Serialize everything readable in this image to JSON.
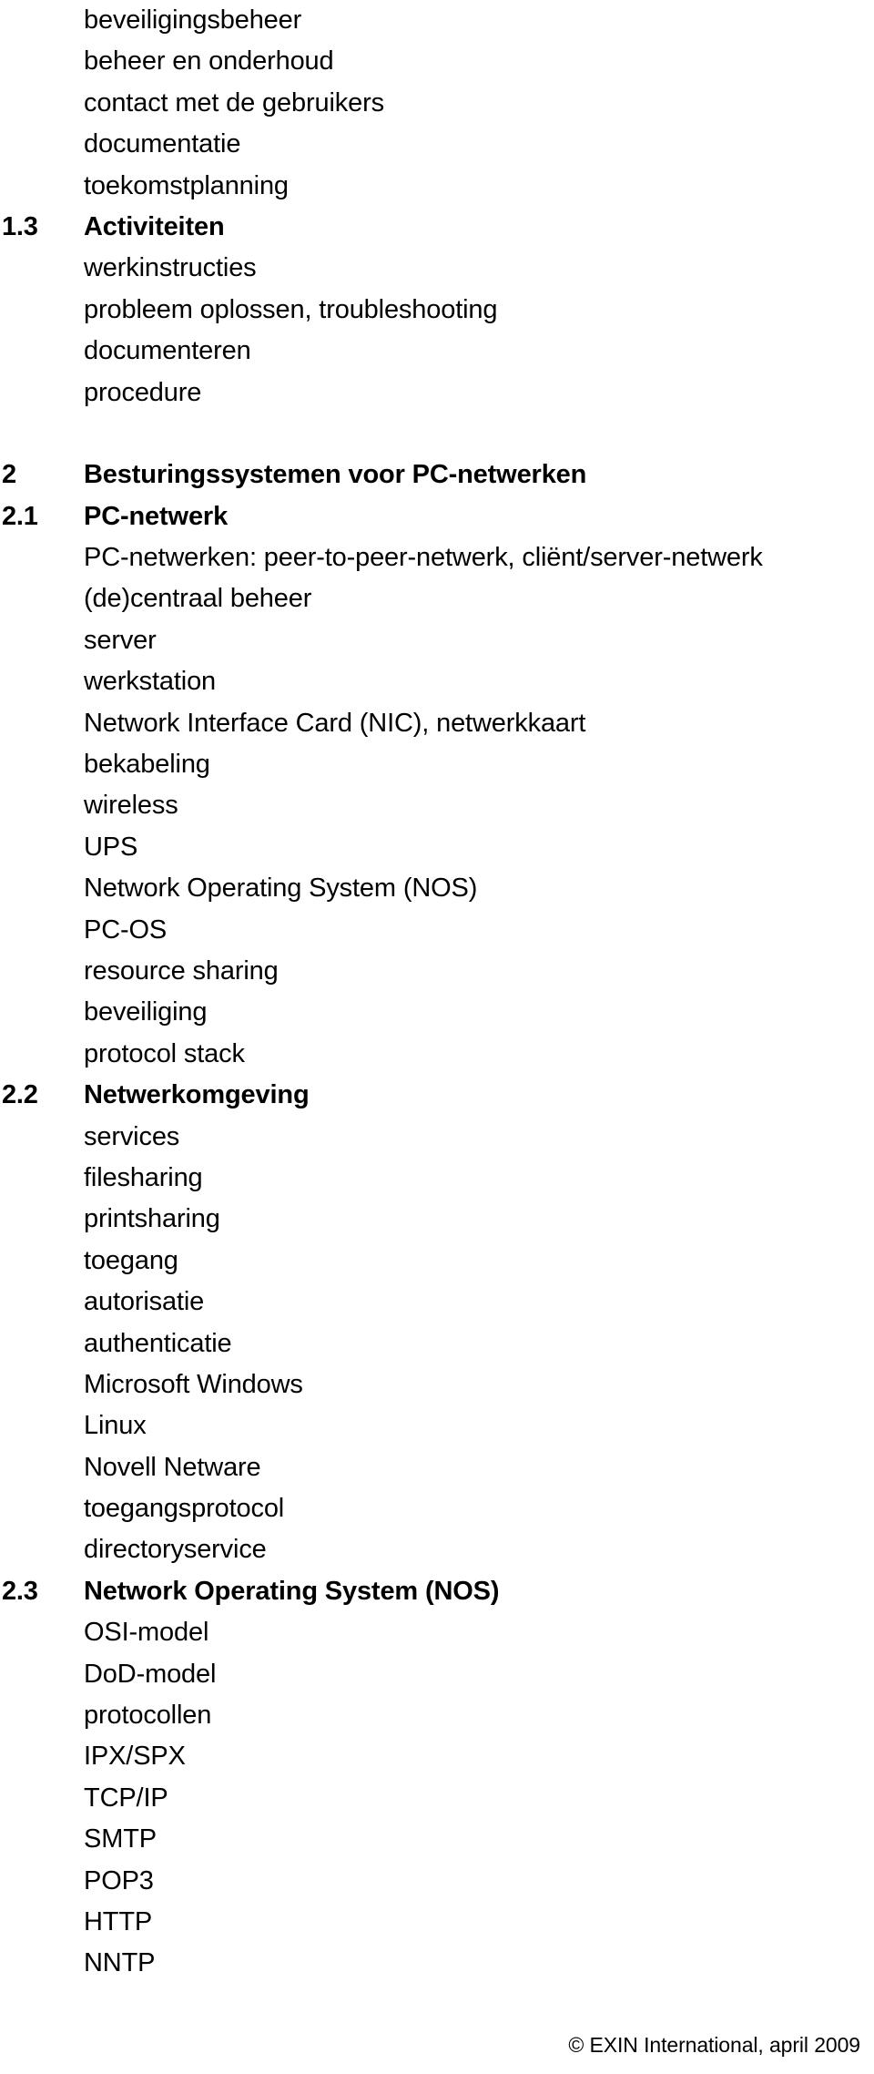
{
  "document": {
    "footer": "© EXIN International, april 2009"
  },
  "outline": {
    "rows": [
      {
        "num": "",
        "text": "beveiligingsbeheer",
        "heading": false
      },
      {
        "num": "",
        "text": "beheer en onderhoud",
        "heading": false
      },
      {
        "num": "",
        "text": "contact met de gebruikers",
        "heading": false
      },
      {
        "num": "",
        "text": "documentatie",
        "heading": false
      },
      {
        "num": "",
        "text": "toekomstplanning",
        "heading": false
      },
      {
        "num": "1.3",
        "text": "Activiteiten",
        "heading": true
      },
      {
        "num": "",
        "text": "werkinstructies",
        "heading": false
      },
      {
        "num": "",
        "text": "probleem oplossen, troubleshooting",
        "heading": false
      },
      {
        "num": "",
        "text": "documenteren",
        "heading": false
      },
      {
        "num": "",
        "text": "procedure",
        "heading": false
      },
      {
        "num": "",
        "text": "",
        "heading": false
      },
      {
        "num": "2",
        "text": "Besturingssystemen voor PC-netwerken",
        "heading": true
      },
      {
        "num": "2.1",
        "text": "PC-netwerk",
        "heading": true
      },
      {
        "num": "",
        "text": "PC-netwerken: peer-to-peer-netwerk, cliënt/server-netwerk",
        "heading": false
      },
      {
        "num": "",
        "text": "(de)centraal beheer",
        "heading": false
      },
      {
        "num": "",
        "text": "server",
        "heading": false
      },
      {
        "num": "",
        "text": "werkstation",
        "heading": false
      },
      {
        "num": "",
        "text": "Network Interface Card (NIC), netwerkkaart",
        "heading": false
      },
      {
        "num": "",
        "text": "bekabeling",
        "heading": false
      },
      {
        "num": "",
        "text": "wireless",
        "heading": false
      },
      {
        "num": "",
        "text": "UPS",
        "heading": false
      },
      {
        "num": "",
        "text": "Network Operating System (NOS)",
        "heading": false
      },
      {
        "num": "",
        "text": "PC-OS",
        "heading": false
      },
      {
        "num": "",
        "text": "resource sharing",
        "heading": false
      },
      {
        "num": "",
        "text": "beveiliging",
        "heading": false
      },
      {
        "num": "",
        "text": "protocol stack",
        "heading": false
      },
      {
        "num": "2.2",
        "text": "Netwerkomgeving",
        "heading": true
      },
      {
        "num": "",
        "text": "services",
        "heading": false
      },
      {
        "num": "",
        "text": "filesharing",
        "heading": false
      },
      {
        "num": "",
        "text": "printsharing",
        "heading": false
      },
      {
        "num": "",
        "text": "toegang",
        "heading": false
      },
      {
        "num": "",
        "text": "autorisatie",
        "heading": false
      },
      {
        "num": "",
        "text": "authenticatie",
        "heading": false
      },
      {
        "num": "",
        "text": "Microsoft Windows",
        "heading": false
      },
      {
        "num": "",
        "text": "Linux",
        "heading": false
      },
      {
        "num": "",
        "text": "Novell Netware",
        "heading": false
      },
      {
        "num": "",
        "text": "toegangsprotocol",
        "heading": false
      },
      {
        "num": "",
        "text": "directoryservice",
        "heading": false
      },
      {
        "num": "2.3",
        "text": "Network Operating System (NOS)",
        "heading": true
      },
      {
        "num": "",
        "text": "OSI-model",
        "heading": false
      },
      {
        "num": "",
        "text": "DoD-model",
        "heading": false
      },
      {
        "num": "",
        "text": "protocollen",
        "heading": false
      },
      {
        "num": "",
        "text": "IPX/SPX",
        "heading": false
      },
      {
        "num": "",
        "text": "TCP/IP",
        "heading": false
      },
      {
        "num": "",
        "text": "SMTP",
        "heading": false
      },
      {
        "num": "",
        "text": "POP3",
        "heading": false
      },
      {
        "num": "",
        "text": "HTTP",
        "heading": false
      },
      {
        "num": "",
        "text": "NNTP",
        "heading": false
      }
    ]
  }
}
